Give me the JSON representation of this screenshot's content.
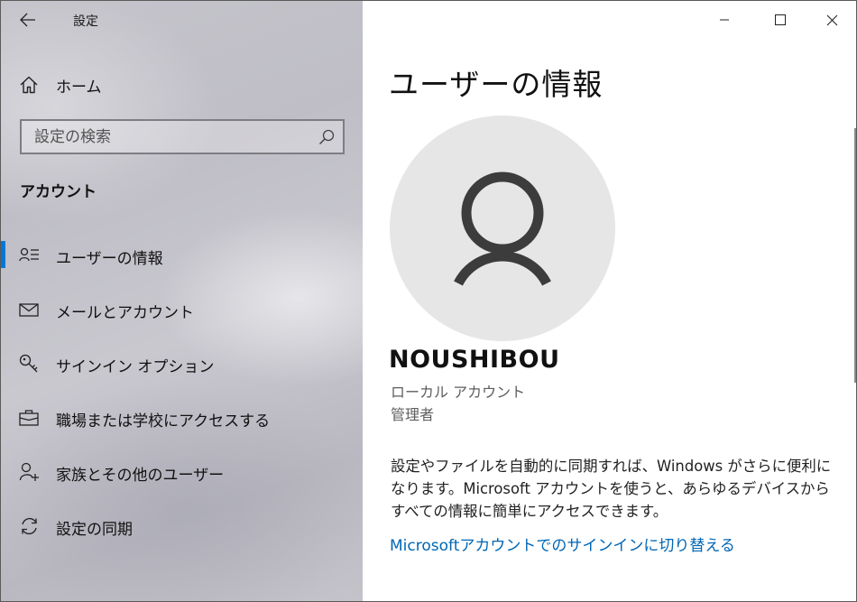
{
  "app": {
    "title": "設定",
    "back_label": "戻る"
  },
  "sidebar": {
    "home_label": "ホーム",
    "search": {
      "placeholder": "設定の検索",
      "value": ""
    },
    "section_title": "アカウント",
    "items": [
      {
        "label": "ユーザーの情報",
        "icon": "person-list-icon",
        "active": true
      },
      {
        "label": "メールとアカウント",
        "icon": "mail-icon",
        "active": false
      },
      {
        "label": "サインイン オプション",
        "icon": "key-icon",
        "active": false
      },
      {
        "label": "職場または学校にアクセスする",
        "icon": "briefcase-icon",
        "active": false
      },
      {
        "label": "家族とその他のユーザー",
        "icon": "person-add-icon",
        "active": false
      },
      {
        "label": "設定の同期",
        "icon": "sync-icon",
        "active": false
      }
    ],
    "accent_color": "#0078d7"
  },
  "main": {
    "page_title": "ユーザーの情報",
    "user": {
      "name": "NOUSHIBOU",
      "account_type": "ローカル アカウント",
      "role": "管理者"
    },
    "description": "設定やファイルを自動的に同期すれば、Windows がさらに便利になります。Microsoft アカウントを使うと、あらゆるデバイスからすべての情報に簡単にアクセスできます。",
    "link_label": "Microsoftアカウントでのサインインに切り替える",
    "link_color": "#0066b4"
  }
}
